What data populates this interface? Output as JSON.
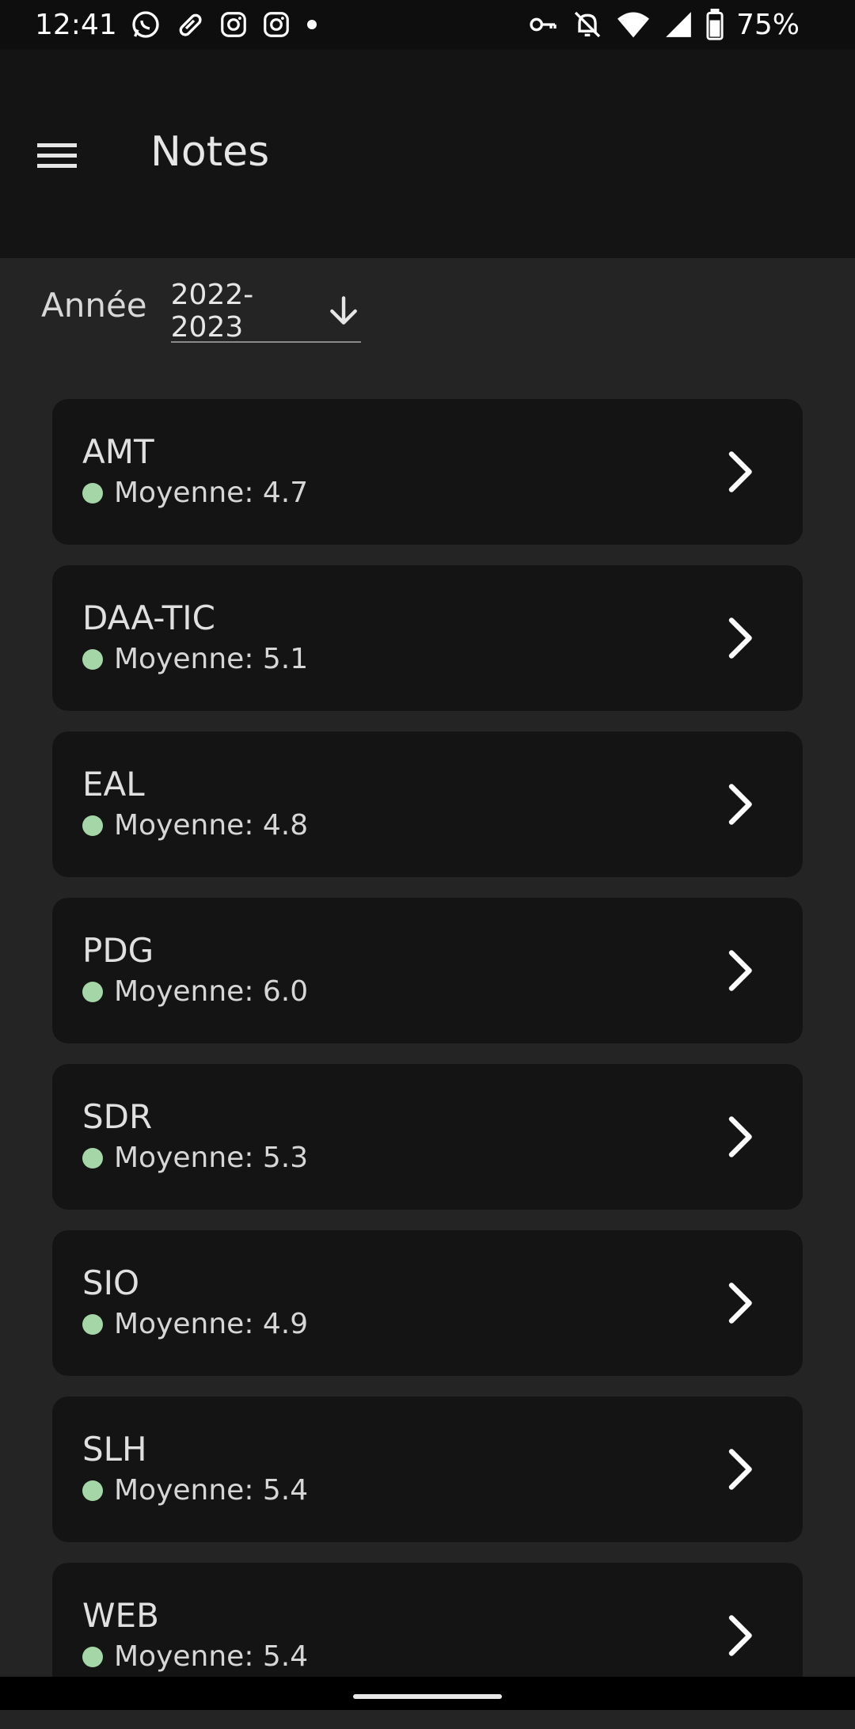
{
  "status_bar": {
    "time": "12:41",
    "battery": "75%",
    "left_icons": [
      "whatsapp-icon",
      "pill-icon",
      "instagram-icon",
      "instagram-icon",
      "dot-icon"
    ],
    "right_icons": [
      "vpn-key-icon",
      "bell-off-icon",
      "wifi-icon",
      "signal-icon",
      "battery-icon"
    ]
  },
  "app_bar": {
    "title": "Notes",
    "menu_icon": "menu-icon"
  },
  "year_filter": {
    "label": "Année",
    "value": "2022-2023",
    "icon": "arrow-down-icon"
  },
  "courses": [
    {
      "name": "AMT",
      "average": "Moyenne: 4.7"
    },
    {
      "name": "DAA-TIC",
      "average": "Moyenne: 5.1"
    },
    {
      "name": "EAL",
      "average": "Moyenne: 4.8"
    },
    {
      "name": "PDG",
      "average": "Moyenne: 6.0"
    },
    {
      "name": "SDR",
      "average": "Moyenne: 5.3"
    },
    {
      "name": "SIO",
      "average": "Moyenne: 4.9"
    },
    {
      "name": "SLH",
      "average": "Moyenne: 5.4"
    },
    {
      "name": "WEB",
      "average": "Moyenne: 5.4"
    }
  ],
  "colors": {
    "status_dot": "#a5d6a7",
    "card_bg": "#141414",
    "page_bg": "#242424"
  }
}
